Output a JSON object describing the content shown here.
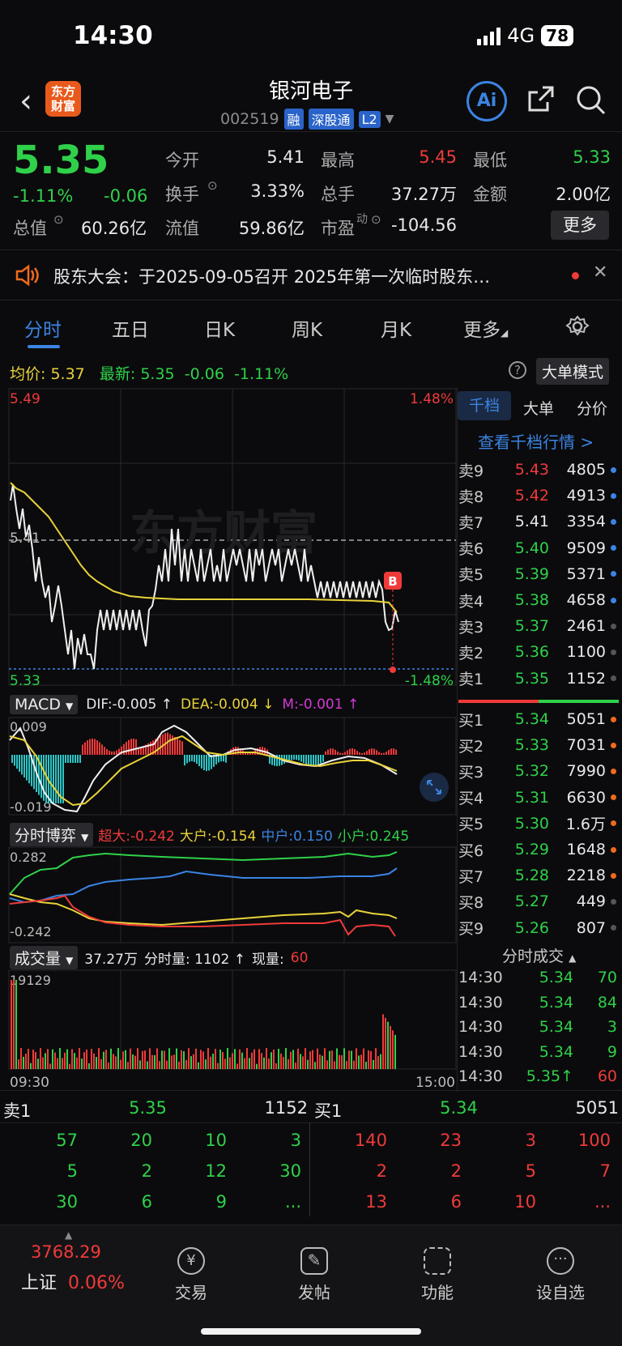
{
  "status_bar": {
    "time": "14:30",
    "network": "4G",
    "battery": "78"
  },
  "header": {
    "stock_name": "银河电子",
    "stock_code": "002519",
    "tags": [
      "融",
      "深股通",
      "L2"
    ],
    "logo_text": "东方财富",
    "ai_label": "Ai"
  },
  "quote": {
    "price": "5.35",
    "change_pct": "-1.11%",
    "change": "-0.06",
    "market_cap_label": "总值",
    "market_cap": "60.26亿",
    "fields": [
      {
        "label": "今开",
        "value": "5.41",
        "color": "#e8e8ea"
      },
      {
        "label": "最高",
        "value": "5.45",
        "color": "#f03a3a"
      },
      {
        "label": "最低",
        "value": "5.33",
        "color": "#2fd14a"
      },
      {
        "label": "换手",
        "value": "3.33%",
        "color": "#e8e8ea"
      },
      {
        "label": "总手",
        "value": "37.27万",
        "color": "#e8e8ea"
      },
      {
        "label": "金额",
        "value": "2.00亿",
        "color": "#e8e8ea"
      },
      {
        "label": "流值",
        "value": "59.86亿",
        "color": "#e8e8ea"
      },
      {
        "label": "市盈",
        "value": "-104.56",
        "color": "#e8e8ea"
      }
    ],
    "pe_superscript": "动",
    "more_label": "更多"
  },
  "notice": {
    "text": "股东大会：于2025-09-05召开 2025年第一次临时股东…"
  },
  "tabs": [
    "分时",
    "五日",
    "日K",
    "周K",
    "月K",
    "更多"
  ],
  "active_tab": "分时",
  "intraday": {
    "avg_label": "均价:",
    "avg_value": "5.37",
    "latest_label": "最新:",
    "latest_value": "5.35",
    "latest_change": "-0.06",
    "latest_pct": "-1.11%",
    "big_order_mode": "大单模式",
    "high_price": "5.49",
    "low_price": "5.33",
    "high_pct": "1.48%",
    "low_pct": "-1.48%",
    "preclose": "5.41",
    "watermark": "东方财富",
    "signal_label": "B",
    "time_start": "09:30",
    "time_end": "15:00"
  },
  "macd": {
    "label": "MACD",
    "dif": "DIF:-0.005 ↑",
    "dea": "DEA:-0.004 ↓",
    "m": "M:-0.001 ↑",
    "top": "0.009",
    "bottom": "-0.019"
  },
  "game": {
    "label": "分时博弈",
    "super": "超大:-0.242",
    "big": "大户:-0.154",
    "mid": "中户:0.150",
    "small": "小户:0.245",
    "top": "0.282",
    "bottom": "-0.242"
  },
  "volume": {
    "label": "成交量",
    "total": "37.27万",
    "minute": "分时量: 1102 ↑",
    "current_label": "现量:",
    "current": "60",
    "max": "19129"
  },
  "order_book": {
    "tabs": [
      "千档",
      "大单",
      "分价"
    ],
    "link": "查看千档行情 >",
    "asks": [
      {
        "label": "卖9",
        "price": "5.43",
        "vol": "4805",
        "pcolor": "#f03a3a",
        "dot": "#3b84e3"
      },
      {
        "label": "卖8",
        "price": "5.42",
        "vol": "4913",
        "pcolor": "#f03a3a",
        "dot": "#3b84e3"
      },
      {
        "label": "卖7",
        "price": "5.41",
        "vol": "3354",
        "pcolor": "#e8e8ea",
        "dot": "#3b84e3"
      },
      {
        "label": "卖6",
        "price": "5.40",
        "vol": "9509",
        "pcolor": "#2fd14a",
        "dot": "#3b84e3"
      },
      {
        "label": "卖5",
        "price": "5.39",
        "vol": "5371",
        "pcolor": "#2fd14a",
        "dot": "#3b84e3"
      },
      {
        "label": "卖4",
        "price": "5.38",
        "vol": "4658",
        "pcolor": "#2fd14a",
        "dot": "#3b84e3"
      },
      {
        "label": "卖3",
        "price": "5.37",
        "vol": "2461",
        "pcolor": "#2fd14a",
        "dot": "#555"
      },
      {
        "label": "卖2",
        "price": "5.36",
        "vol": "1100",
        "pcolor": "#2fd14a",
        "dot": "#555"
      },
      {
        "label": "卖1",
        "price": "5.35",
        "vol": "1152",
        "pcolor": "#2fd14a",
        "dot": "#555"
      }
    ],
    "bids": [
      {
        "label": "买1",
        "price": "5.34",
        "vol": "5051",
        "pcolor": "#2fd14a",
        "dot": "#f06a1c"
      },
      {
        "label": "买2",
        "price": "5.33",
        "vol": "7031",
        "pcolor": "#2fd14a",
        "dot": "#f06a1c"
      },
      {
        "label": "买3",
        "price": "5.32",
        "vol": "7990",
        "pcolor": "#2fd14a",
        "dot": "#f06a1c"
      },
      {
        "label": "买4",
        "price": "5.31",
        "vol": "6630",
        "pcolor": "#2fd14a",
        "dot": "#f06a1c"
      },
      {
        "label": "买5",
        "price": "5.30",
        "vol": "1.6万",
        "pcolor": "#2fd14a",
        "dot": "#f06a1c"
      },
      {
        "label": "买6",
        "price": "5.29",
        "vol": "1648",
        "pcolor": "#2fd14a",
        "dot": "#f06a1c"
      },
      {
        "label": "买7",
        "price": "5.28",
        "vol": "2218",
        "pcolor": "#2fd14a",
        "dot": "#f06a1c"
      },
      {
        "label": "买8",
        "price": "5.27",
        "vol": "449",
        "pcolor": "#2fd14a",
        "dot": "#555"
      },
      {
        "label": "买9",
        "price": "5.26",
        "vol": "807",
        "pcolor": "#2fd14a",
        "dot": "#555"
      }
    ],
    "ticks_label": "分时成交",
    "ticks": [
      {
        "time": "14:30",
        "price": "5.34",
        "vol": "70",
        "vcolor": "#2fd14a"
      },
      {
        "time": "14:30",
        "price": "5.34",
        "vol": "84",
        "vcolor": "#2fd14a"
      },
      {
        "time": "14:30",
        "price": "5.34",
        "vol": "3",
        "vcolor": "#2fd14a"
      },
      {
        "time": "14:30",
        "price": "5.34",
        "vol": "9",
        "vcolor": "#2fd14a"
      },
      {
        "time": "14:30",
        "price": "5.35↑",
        "vol": "60",
        "vcolor": "#f03a3a"
      }
    ]
  },
  "bottom_book": {
    "ask_label": "卖1",
    "ask_price": "5.35",
    "ask_vol": "1152",
    "bid_label": "买1",
    "bid_price": "5.34",
    "bid_vol": "5051",
    "ask_queue": [
      [
        "57",
        "20",
        "10",
        "3"
      ],
      [
        "5",
        "2",
        "12",
        "30"
      ],
      [
        "30",
        "6",
        "9",
        "..."
      ]
    ],
    "bid_queue": [
      [
        "140",
        "23",
        "3",
        "100"
      ],
      [
        "2",
        "2",
        "5",
        "7"
      ],
      [
        "13",
        "6",
        "10",
        "..."
      ]
    ]
  },
  "bottom_nav": {
    "index_value": "3768.29",
    "index_name": "上证",
    "index_pct": "0.06%",
    "items": [
      "交易",
      "发帖",
      "功能",
      "设自选"
    ]
  }
}
